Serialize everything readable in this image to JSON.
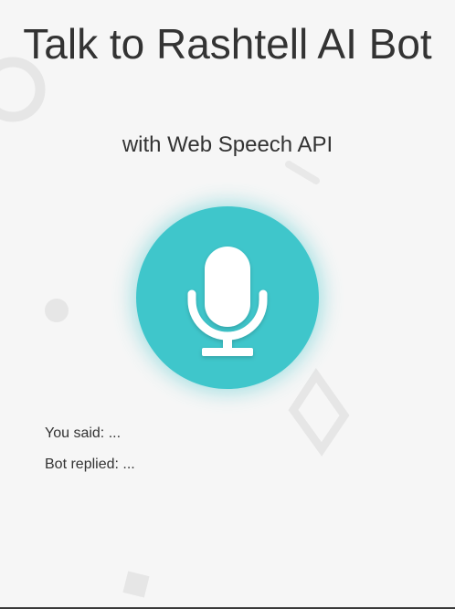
{
  "header": {
    "title": "Talk to Rashtell AI Bot",
    "subtitle": "with Web Speech API"
  },
  "mic": {
    "icon": "microphone-icon",
    "color": "#3fc6cb"
  },
  "conversation": {
    "you_said_label": "You said:",
    "you_said_value": "...",
    "bot_replied_label": "Bot replied:",
    "bot_replied_value": "..."
  },
  "colors": {
    "background": "#f6f6f6",
    "text": "#333333",
    "accent": "#3fc6cb"
  }
}
